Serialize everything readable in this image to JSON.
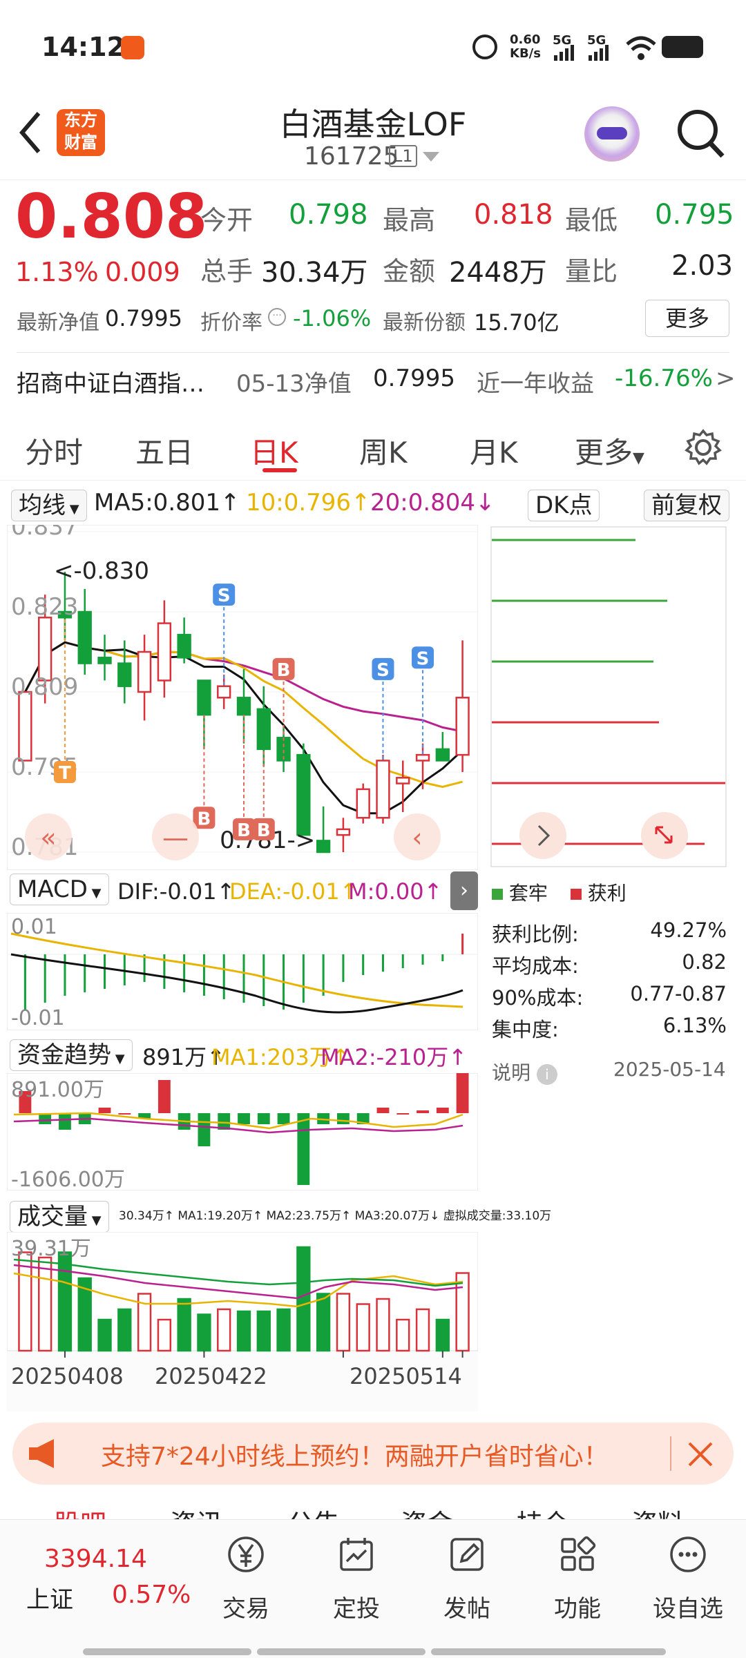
{
  "status": {
    "time": "14:12",
    "speed_top": "0.60",
    "speed_bottom": "KB/s",
    "sig1": "5G",
    "sig2": "5G"
  },
  "header": {
    "logo_line1": "东方",
    "logo_line2": "财富",
    "title": "白酒基金LOF",
    "code": "161725",
    "level": "L1"
  },
  "quote": {
    "price": "0.808",
    "change_pct": "1.13%",
    "change": "0.009",
    "open_label": "今开",
    "open": "0.798",
    "high_label": "最高",
    "high": "0.818",
    "low_label": "最低",
    "low": "0.795",
    "vol_label": "总手",
    "vol": "30.34万",
    "amt_label": "金额",
    "amt": "2448万",
    "ratio_label": "量比",
    "ratio": "2.03",
    "nav_label": "最新净值",
    "nav": "0.7995",
    "discount_label": "折价率",
    "discount": "-1.06%",
    "share_label": "最新份额",
    "share": "15.70亿",
    "more": "更多",
    "index_name": "招商中证白酒指…",
    "nav_date_label": "05-13净值",
    "nav2": "0.7995",
    "year_label": "近一年收益",
    "year_ret": "-16.76%",
    "year_arrow": ">"
  },
  "tabs": {
    "t1": "分时",
    "t2": "五日",
    "t3": "日K",
    "t4": "周K",
    "t5": "月K",
    "t6": "更多"
  },
  "chart_toolbar": {
    "ma_select": "均线",
    "ma5": "MA5:0.801",
    "ma10": "10:0.796",
    "ma20": "20:0.804",
    "dk": "DK点",
    "adjust": "前复权"
  },
  "chart_data": {
    "type": "candlestick",
    "y_ticks": [
      "0.837",
      "0.823",
      "0.809",
      "0.795",
      "0.781"
    ],
    "ylim": [
      0.781,
      0.837
    ],
    "x_labels": [
      "20250408",
      "20250422",
      "20250514"
    ],
    "annotations": {
      "max": "<-0.830",
      "min": "0.781->"
    },
    "markers": [
      "T",
      "S",
      "B",
      "B",
      "B",
      "B",
      "S",
      "S"
    ],
    "candles": [
      {
        "o": 0.797,
        "h": 0.809,
        "l": 0.797,
        "c": 0.809
      },
      {
        "o": 0.811,
        "h": 0.826,
        "l": 0.807,
        "c": 0.822
      },
      {
        "o": 0.823,
        "h": 0.83,
        "l": 0.818,
        "c": 0.822
      },
      {
        "o": 0.823,
        "h": 0.827,
        "l": 0.812,
        "c": 0.814
      },
      {
        "o": 0.815,
        "h": 0.819,
        "l": 0.811,
        "c": 0.814
      },
      {
        "o": 0.814,
        "h": 0.818,
        "l": 0.807,
        "c": 0.81
      },
      {
        "o": 0.809,
        "h": 0.819,
        "l": 0.804,
        "c": 0.816
      },
      {
        "o": 0.811,
        "h": 0.825,
        "l": 0.808,
        "c": 0.821
      },
      {
        "o": 0.819,
        "h": 0.822,
        "l": 0.814,
        "c": 0.815
      },
      {
        "o": 0.811,
        "h": 0.811,
        "l": 0.799,
        "c": 0.805
      },
      {
        "o": 0.808,
        "h": 0.812,
        "l": 0.806,
        "c": 0.81
      },
      {
        "o": 0.808,
        "h": 0.813,
        "l": 0.8,
        "c": 0.805
      },
      {
        "o": 0.806,
        "h": 0.81,
        "l": 0.796,
        "c": 0.799
      },
      {
        "o": 0.801,
        "h": 0.803,
        "l": 0.795,
        "c": 0.797
      },
      {
        "o": 0.798,
        "h": 0.8,
        "l": 0.784,
        "c": 0.784
      },
      {
        "o": 0.783,
        "h": 0.789,
        "l": 0.781,
        "c": 0.781
      },
      {
        "o": 0.784,
        "h": 0.787,
        "l": 0.781,
        "c": 0.785
      },
      {
        "o": 0.787,
        "h": 0.793,
        "l": 0.786,
        "c": 0.792
      },
      {
        "o": 0.787,
        "h": 0.798,
        "l": 0.786,
        "c": 0.797
      },
      {
        "o": 0.793,
        "h": 0.797,
        "l": 0.788,
        "c": 0.794
      },
      {
        "o": 0.797,
        "h": 0.8,
        "l": 0.792,
        "c": 0.798
      },
      {
        "o": 0.799,
        "h": 0.802,
        "l": 0.797,
        "c": 0.797
      },
      {
        "o": 0.798,
        "h": 0.818,
        "l": 0.795,
        "c": 0.808
      }
    ],
    "ma_colors": {
      "ma5": "#111111",
      "ma10": "#e8b400",
      "ma20": "#b8218f"
    }
  },
  "dk_panel": {
    "legend_hold": "套牢",
    "legend_profit": "获利",
    "rows": [
      {
        "label": "获利比例:",
        "value": "49.27%"
      },
      {
        "label": "平均成本:",
        "value": "0.82"
      },
      {
        "label": "90%成本:",
        "value": "0.77-0.87"
      },
      {
        "label": "集中度:",
        "value": "6.13%"
      }
    ],
    "note": "说明",
    "date": "2025-05-14"
  },
  "macd": {
    "select": "MACD",
    "dif": "DIF:-0.01",
    "dea": "DEA:-0.01",
    "m": "M:0.00",
    "top": "0.01",
    "bottom": "-0.01"
  },
  "fund": {
    "select": "资金趋势",
    "value": "891万",
    "ma1": "MA1:203万",
    "ma2": "MA2:-210万",
    "top": "891.00万",
    "bottom": "-1606.00万"
  },
  "volume": {
    "select": "成交量",
    "line": "30.34万↑ MA1:19.20万↑ MA2:23.75万↑ MA3:20.07万↓ 虚拟成交量:33.10万",
    "top": "39.31万"
  },
  "banner": {
    "text": "支持7*24小时线上预约！两融开户省时省心！"
  },
  "bottom": {
    "index_value": "3394.14",
    "index_name": "上证",
    "index_pct": "0.57%",
    "items": [
      "交易",
      "定投",
      "发帖",
      "功能",
      "设自选"
    ],
    "peek": [
      "股吧",
      "资讯",
      "公告",
      "资金",
      "持仓",
      "资料"
    ]
  }
}
